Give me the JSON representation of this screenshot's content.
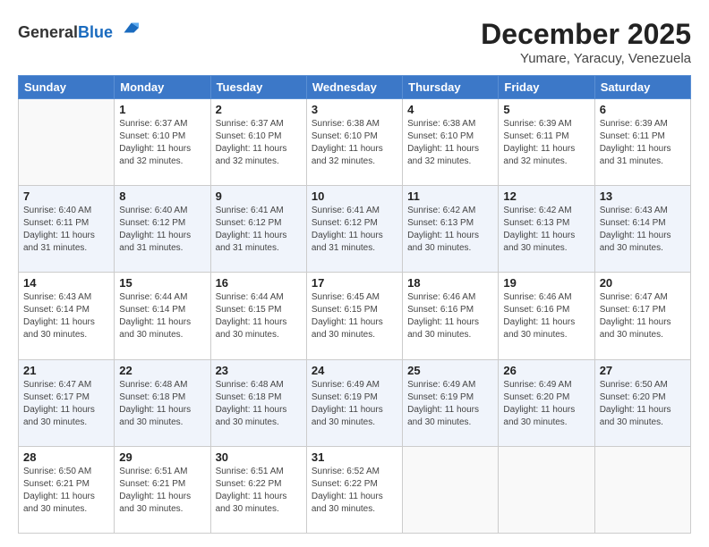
{
  "logo": {
    "general": "General",
    "blue": "Blue"
  },
  "title": "December 2025",
  "subtitle": "Yumare, Yaracuy, Venezuela",
  "days_header": [
    "Sunday",
    "Monday",
    "Tuesday",
    "Wednesday",
    "Thursday",
    "Friday",
    "Saturday"
  ],
  "weeks": [
    [
      {
        "day": "",
        "info": ""
      },
      {
        "day": "1",
        "info": "Sunrise: 6:37 AM\nSunset: 6:10 PM\nDaylight: 11 hours and 32 minutes."
      },
      {
        "day": "2",
        "info": "Sunrise: 6:37 AM\nSunset: 6:10 PM\nDaylight: 11 hours and 32 minutes."
      },
      {
        "day": "3",
        "info": "Sunrise: 6:38 AM\nSunset: 6:10 PM\nDaylight: 11 hours and 32 minutes."
      },
      {
        "day": "4",
        "info": "Sunrise: 6:38 AM\nSunset: 6:10 PM\nDaylight: 11 hours and 32 minutes."
      },
      {
        "day": "5",
        "info": "Sunrise: 6:39 AM\nSunset: 6:11 PM\nDaylight: 11 hours and 32 minutes."
      },
      {
        "day": "6",
        "info": "Sunrise: 6:39 AM\nSunset: 6:11 PM\nDaylight: 11 hours and 31 minutes."
      }
    ],
    [
      {
        "day": "7",
        "info": "Sunrise: 6:40 AM\nSunset: 6:11 PM\nDaylight: 11 hours and 31 minutes."
      },
      {
        "day": "8",
        "info": "Sunrise: 6:40 AM\nSunset: 6:12 PM\nDaylight: 11 hours and 31 minutes."
      },
      {
        "day": "9",
        "info": "Sunrise: 6:41 AM\nSunset: 6:12 PM\nDaylight: 11 hours and 31 minutes."
      },
      {
        "day": "10",
        "info": "Sunrise: 6:41 AM\nSunset: 6:12 PM\nDaylight: 11 hours and 31 minutes."
      },
      {
        "day": "11",
        "info": "Sunrise: 6:42 AM\nSunset: 6:13 PM\nDaylight: 11 hours and 30 minutes."
      },
      {
        "day": "12",
        "info": "Sunrise: 6:42 AM\nSunset: 6:13 PM\nDaylight: 11 hours and 30 minutes."
      },
      {
        "day": "13",
        "info": "Sunrise: 6:43 AM\nSunset: 6:14 PM\nDaylight: 11 hours and 30 minutes."
      }
    ],
    [
      {
        "day": "14",
        "info": "Sunrise: 6:43 AM\nSunset: 6:14 PM\nDaylight: 11 hours and 30 minutes."
      },
      {
        "day": "15",
        "info": "Sunrise: 6:44 AM\nSunset: 6:14 PM\nDaylight: 11 hours and 30 minutes."
      },
      {
        "day": "16",
        "info": "Sunrise: 6:44 AM\nSunset: 6:15 PM\nDaylight: 11 hours and 30 minutes."
      },
      {
        "day": "17",
        "info": "Sunrise: 6:45 AM\nSunset: 6:15 PM\nDaylight: 11 hours and 30 minutes."
      },
      {
        "day": "18",
        "info": "Sunrise: 6:46 AM\nSunset: 6:16 PM\nDaylight: 11 hours and 30 minutes."
      },
      {
        "day": "19",
        "info": "Sunrise: 6:46 AM\nSunset: 6:16 PM\nDaylight: 11 hours and 30 minutes."
      },
      {
        "day": "20",
        "info": "Sunrise: 6:47 AM\nSunset: 6:17 PM\nDaylight: 11 hours and 30 minutes."
      }
    ],
    [
      {
        "day": "21",
        "info": "Sunrise: 6:47 AM\nSunset: 6:17 PM\nDaylight: 11 hours and 30 minutes."
      },
      {
        "day": "22",
        "info": "Sunrise: 6:48 AM\nSunset: 6:18 PM\nDaylight: 11 hours and 30 minutes."
      },
      {
        "day": "23",
        "info": "Sunrise: 6:48 AM\nSunset: 6:18 PM\nDaylight: 11 hours and 30 minutes."
      },
      {
        "day": "24",
        "info": "Sunrise: 6:49 AM\nSunset: 6:19 PM\nDaylight: 11 hours and 30 minutes."
      },
      {
        "day": "25",
        "info": "Sunrise: 6:49 AM\nSunset: 6:19 PM\nDaylight: 11 hours and 30 minutes."
      },
      {
        "day": "26",
        "info": "Sunrise: 6:49 AM\nSunset: 6:20 PM\nDaylight: 11 hours and 30 minutes."
      },
      {
        "day": "27",
        "info": "Sunrise: 6:50 AM\nSunset: 6:20 PM\nDaylight: 11 hours and 30 minutes."
      }
    ],
    [
      {
        "day": "28",
        "info": "Sunrise: 6:50 AM\nSunset: 6:21 PM\nDaylight: 11 hours and 30 minutes."
      },
      {
        "day": "29",
        "info": "Sunrise: 6:51 AM\nSunset: 6:21 PM\nDaylight: 11 hours and 30 minutes."
      },
      {
        "day": "30",
        "info": "Sunrise: 6:51 AM\nSunset: 6:22 PM\nDaylight: 11 hours and 30 minutes."
      },
      {
        "day": "31",
        "info": "Sunrise: 6:52 AM\nSunset: 6:22 PM\nDaylight: 11 hours and 30 minutes."
      },
      {
        "day": "",
        "info": ""
      },
      {
        "day": "",
        "info": ""
      },
      {
        "day": "",
        "info": ""
      }
    ]
  ]
}
